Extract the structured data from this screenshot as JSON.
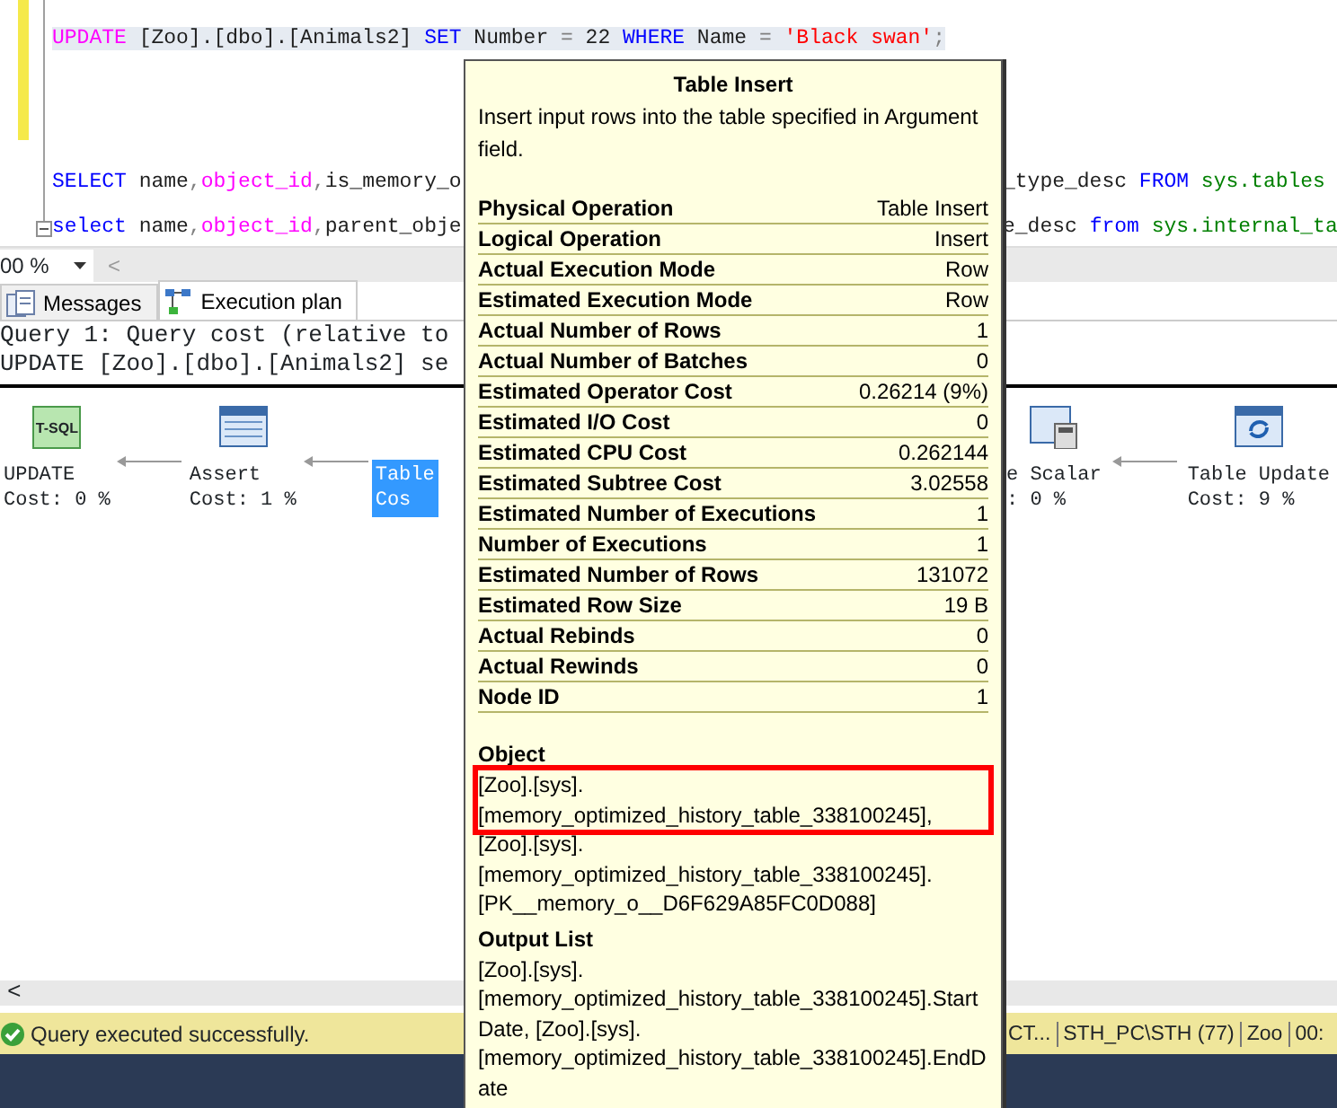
{
  "editor": {
    "lines": [
      {
        "highlighted": true,
        "left": [
          {
            "kind": "function",
            "text": "UPDATE"
          },
          {
            "kind": "plain",
            "text": " [Zoo].[dbo].[Animals2] "
          },
          {
            "kind": "keyword",
            "text": "SET"
          },
          {
            "kind": "plain",
            "text": " Number "
          },
          {
            "kind": "operator",
            "text": "="
          },
          {
            "kind": "plain",
            "text": " 22 "
          },
          {
            "kind": "keyword",
            "text": "WHERE"
          },
          {
            "kind": "plain",
            "text": " Name "
          },
          {
            "kind": "operator",
            "text": "="
          },
          {
            "kind": "string",
            "text": " 'Black swan'"
          },
          {
            "kind": "operator",
            "text": ";"
          }
        ]
      },
      {
        "highlighted": false,
        "left": [
          {
            "kind": "keyword",
            "text": "SELECT"
          },
          {
            "kind": "plain",
            "text": " name"
          },
          {
            "kind": "operator",
            "text": ","
          },
          {
            "kind": "function",
            "text": "object_id"
          },
          {
            "kind": "operator",
            "text": ","
          },
          {
            "kind": "plain",
            "text": "is_memory_o"
          }
        ],
        "right": [
          {
            "kind": "plain",
            "text": "_type_desc "
          },
          {
            "kind": "keyword",
            "text": "FROM"
          },
          {
            "kind": "system",
            "text": " sys.tables"
          }
        ]
      },
      {
        "highlighted": false,
        "collapsible": true,
        "left": [
          {
            "kind": "keyword",
            "text": "select"
          },
          {
            "kind": "plain",
            "text": " name"
          },
          {
            "kind": "operator",
            "text": ","
          },
          {
            "kind": "function",
            "text": "object_id"
          },
          {
            "kind": "operator",
            "text": ","
          },
          {
            "kind": "plain",
            "text": "parent_obje"
          }
        ],
        "right": [
          {
            "kind": "plain",
            "text": "e_desc "
          },
          {
            "kind": "keyword",
            "text": "from"
          },
          {
            "kind": "system",
            "text": " sys.internal_ta"
          }
        ]
      }
    ]
  },
  "zoom": {
    "value": "00 %",
    "scroll_left": "<"
  },
  "tabs": [
    {
      "label": "Messages",
      "kind": "messages",
      "selected": false
    },
    {
      "label": "Execution plan",
      "kind": "plan",
      "selected": true
    }
  ],
  "results": {
    "header_lines": [
      "Query 1: Query cost (relative to",
      "UPDATE [Zoo].[dbo].[Animals2] se"
    ],
    "plan_left": [
      {
        "kind": "tsql",
        "badge": "T-SQL",
        "label": "UPDATE",
        "cost": "Cost: 0 %",
        "selected": false
      },
      {
        "kind": "grid",
        "label": "Assert",
        "cost": "Cost: 1 %",
        "selected": false
      },
      {
        "kind": "hidden",
        "label": "Table",
        "cost": "Cos",
        "selected": true
      }
    ],
    "plan_right": [
      {
        "kind": "calc",
        "label": "e Scalar",
        "cost": ": 0 %",
        "selected": false
      },
      {
        "kind": "update",
        "label": "Table Update",
        "cost": "Cost: 9 %",
        "selected": false
      }
    ],
    "scroll_left": "<"
  },
  "status_bar": {
    "message": "Query executed successfully.",
    "segments": [
      "CT...",
      "STH_PC\\STH (77)",
      "Zoo",
      "00:"
    ]
  },
  "tooltip": {
    "title": "Table Insert",
    "description": "Insert input rows into the table specified in Argument field.",
    "properties": [
      {
        "label": "Physical Operation",
        "value": "Table Insert"
      },
      {
        "label": "Logical Operation",
        "value": "Insert"
      },
      {
        "label": "Actual Execution Mode",
        "value": "Row"
      },
      {
        "label": "Estimated Execution Mode",
        "value": "Row"
      },
      {
        "label": "Actual Number of Rows",
        "value": "1"
      },
      {
        "label": "Actual Number of Batches",
        "value": "0"
      },
      {
        "label": "Estimated Operator Cost",
        "value": "0.26214 (9%)"
      },
      {
        "label": "Estimated I/O Cost",
        "value": "0"
      },
      {
        "label": "Estimated CPU Cost",
        "value": "0.262144"
      },
      {
        "label": "Estimated Subtree Cost",
        "value": "3.02558"
      },
      {
        "label": "Estimated Number of Executions",
        "value": "1"
      },
      {
        "label": "Number of Executions",
        "value": "1"
      },
      {
        "label": "Estimated Number of Rows",
        "value": "131072"
      },
      {
        "label": "Estimated Row Size",
        "value": "19 B"
      },
      {
        "label": "Actual Rebinds",
        "value": "0"
      },
      {
        "label": "Actual Rewinds",
        "value": "0"
      },
      {
        "label": "Node ID",
        "value": "1"
      }
    ],
    "object": {
      "heading": "Object",
      "items": [
        {
          "text": "[Zoo].[sys].[memory_optimized_history_table_338100245],",
          "highlighted": true
        },
        {
          "text": "[Zoo].[sys].[memory_optimized_history_table_338100245].[PK__memory_o__D6F629A85FC0D088]",
          "highlighted": false
        }
      ]
    },
    "output_list": {
      "heading": "Output List",
      "text": "[Zoo].[sys].[memory_optimized_history_table_338100245].StartDate, [Zoo].[sys].[memory_optimized_history_table_338100245].EndDate"
    }
  }
}
